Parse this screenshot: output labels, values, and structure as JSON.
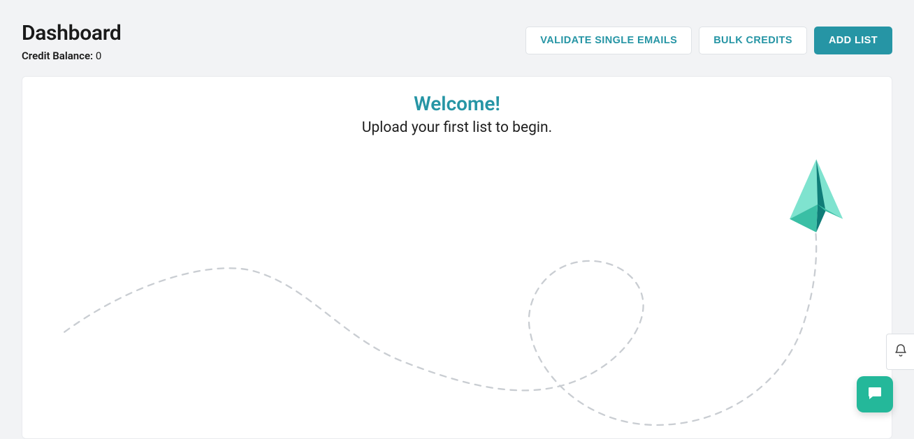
{
  "header": {
    "title": "Dashboard",
    "credit_label": "Credit Balance:",
    "credit_value": "0"
  },
  "actions": {
    "validate_single": "VALIDATE SINGLE EMAILS",
    "bulk_credits": "BULK CREDITS",
    "add_list": "ADD LIST"
  },
  "main": {
    "welcome_title": "Welcome!",
    "welcome_subtitle": "Upload your first list to begin."
  },
  "colors": {
    "accent": "#2695a5",
    "chat": "#24b89a",
    "plane_light": "#7fe3cf",
    "plane_mid": "#3abfa5",
    "plane_dark": "#0f7d78"
  }
}
